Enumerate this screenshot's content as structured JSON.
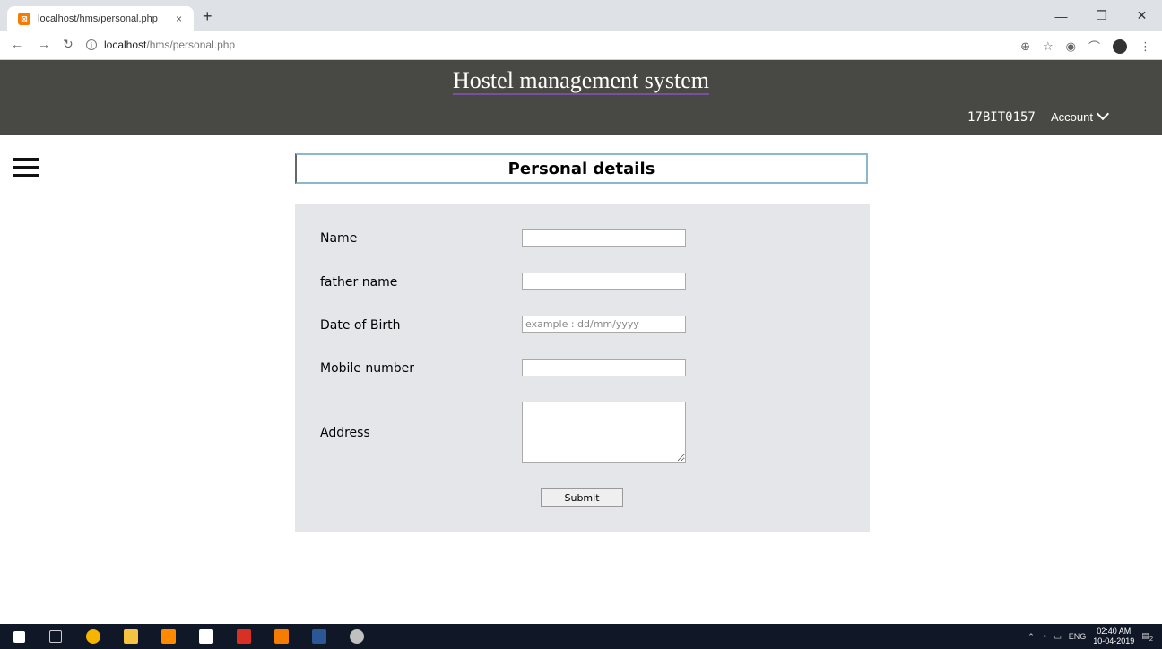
{
  "browser": {
    "tab_title": "localhost/hms/personal.php",
    "tab_close": "×",
    "new_tab": "+",
    "url_host": "localhost",
    "url_path": "/hms/personal.php",
    "window_controls": [
      "—",
      "❐",
      "✕"
    ]
  },
  "header": {
    "title": "Hostel management system",
    "user_id": "17BIT0157",
    "account_label": "Account"
  },
  "page": {
    "section_title": "Personal details"
  },
  "form": {
    "fields": [
      {
        "label": "Name",
        "value": "",
        "placeholder": ""
      },
      {
        "label": "father name",
        "value": "",
        "placeholder": ""
      },
      {
        "label": "Date of Birth",
        "value": "",
        "placeholder": "example : dd/mm/yyyy"
      },
      {
        "label": "Mobile number",
        "value": "",
        "placeholder": ""
      }
    ],
    "address_label": "Address",
    "submit_label": "Submit"
  },
  "taskbar": {
    "language": "ENG",
    "time": "02:40 AM",
    "date": "10-04-2019",
    "notification_count": "2"
  },
  "colors": {
    "header_bg": "#484844",
    "panel_bg": "#e4e6ea",
    "title_border": "#8ab8cc"
  }
}
